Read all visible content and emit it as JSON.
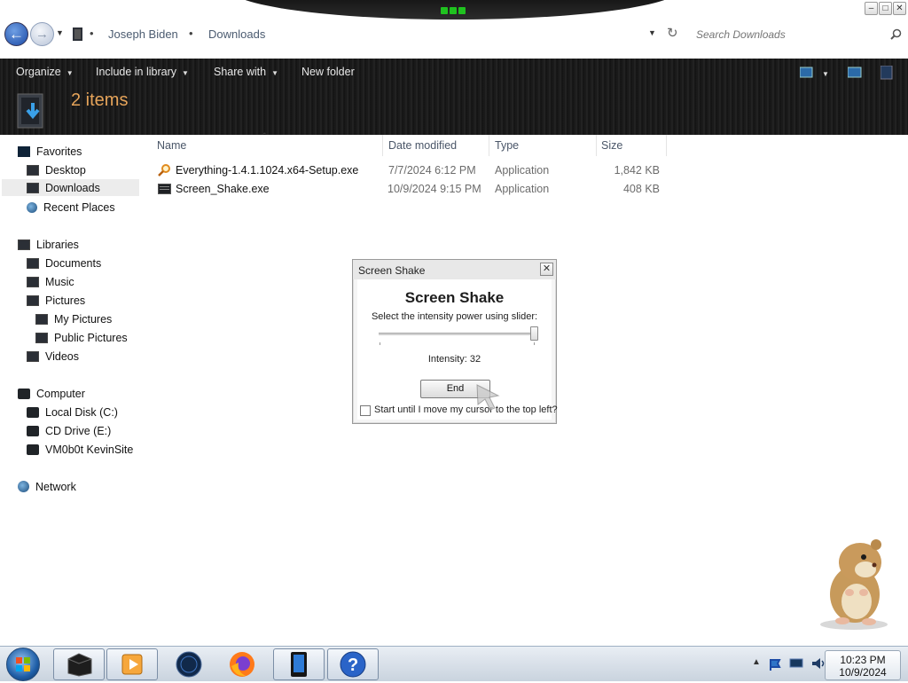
{
  "window": {
    "controls": [
      "minimize",
      "maximize",
      "close"
    ]
  },
  "address": {
    "breadcrumbs": [
      "Joseph Biden",
      "Downloads"
    ],
    "search_placeholder": "Search Downloads"
  },
  "toolbar": {
    "organize": "Organize",
    "include_in_library": "Include in library",
    "share_with": "Share with",
    "new_folder": "New folder",
    "items_count": "2 items"
  },
  "navpane": {
    "favorites": {
      "label": "Favorites",
      "items": [
        "Desktop",
        "Downloads",
        "Recent Places"
      ]
    },
    "libraries": {
      "label": "Libraries",
      "items": [
        "Documents",
        "Music",
        "Pictures",
        "My Pictures",
        "Public Pictures",
        "Videos"
      ]
    },
    "computer": {
      "label": "Computer",
      "items": [
        "Local Disk (C:)",
        "CD Drive (E:)",
        "VM0b0t KevinSite"
      ]
    },
    "network": "Network"
  },
  "filelist": {
    "columns": [
      "Name",
      "Date modified",
      "Type",
      "Size"
    ],
    "rows": [
      {
        "name": "Everything-1.4.1.1024.x64-Setup.exe",
        "date": "7/7/2024 6:12 PM",
        "type": "Application",
        "size": "1,842 KB",
        "icon": "magnifier-setup-icon"
      },
      {
        "name": "Screen_Shake.exe",
        "date": "10/9/2024 9:15 PM",
        "type": "Application",
        "size": "408 KB",
        "icon": "exe-window-icon"
      }
    ]
  },
  "dialog": {
    "title": "Screen Shake",
    "heading": "Screen Shake",
    "instruction": "Select the intensity power using slider:",
    "intensity_label": "Intensity: 32",
    "intensity_value": 32,
    "end_button": "End",
    "checkbox_label": "Start until I move my cursor to the top left?",
    "checkbox_checked": false
  },
  "taskbar": {
    "apps": [
      "explorer-icon",
      "media-player-icon",
      "globe-icon",
      "firefox-icon",
      "tablet-icon",
      "help-icon"
    ],
    "clock_time": "10:23 PM",
    "clock_date": "10/9/2024"
  },
  "colors": {
    "toolbar_bg": "#1b1b1b",
    "items_count": "#e6a45a",
    "accent_blue": "#1b4aa5"
  }
}
